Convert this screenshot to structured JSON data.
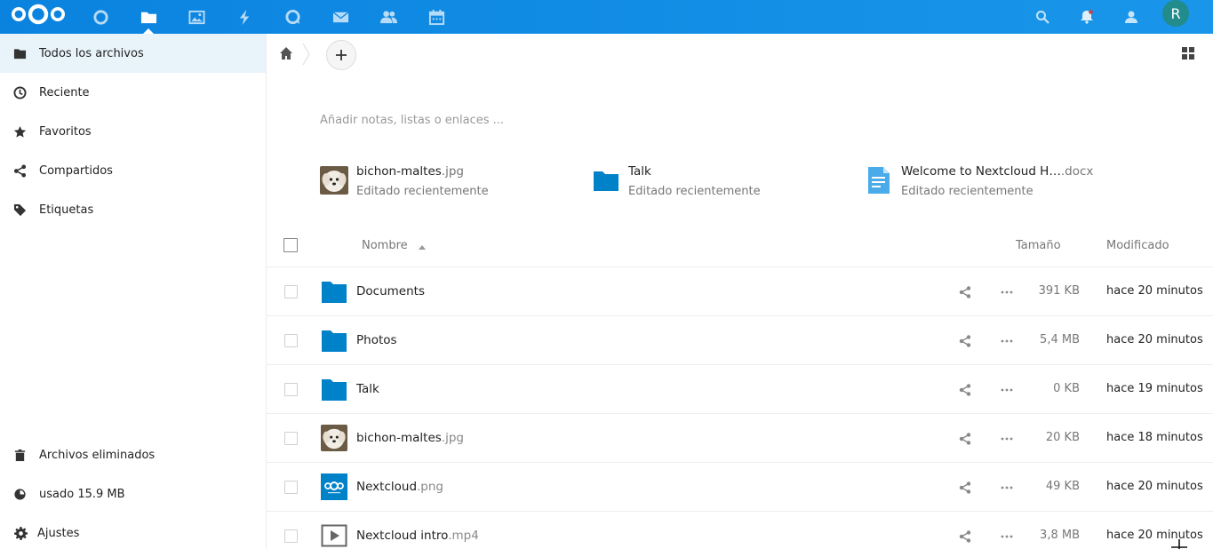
{
  "header": {
    "apps": [
      {
        "name": "dashboard"
      },
      {
        "name": "files",
        "active": true
      },
      {
        "name": "photos"
      },
      {
        "name": "activity"
      },
      {
        "name": "talk"
      },
      {
        "name": "mail"
      },
      {
        "name": "contacts"
      },
      {
        "name": "calendar"
      }
    ],
    "avatar_initial": "R",
    "accent": "#0e8ee9"
  },
  "sidebar": {
    "items": [
      {
        "label": "Todos los archivos",
        "icon": "folder-icon",
        "active": true
      },
      {
        "label": "Reciente",
        "icon": "clock-icon"
      },
      {
        "label": "Favoritos",
        "icon": "star-icon"
      },
      {
        "label": "Compartidos",
        "icon": "share-icon"
      },
      {
        "label": "Etiquetas",
        "icon": "tag-icon"
      }
    ],
    "bottom": {
      "deleted": "Archivos eliminados",
      "quota": "usado 15.9 MB",
      "settings": "Ajustes"
    }
  },
  "main": {
    "notes_placeholder": "Añadir notas, listas o enlaces ...",
    "recent": [
      {
        "name": "bichon-maltes",
        "ext": ".jpg",
        "sub": "Editado recientemente",
        "type": "image"
      },
      {
        "name": "Talk",
        "ext": "",
        "sub": "Editado recientemente",
        "type": "folder"
      },
      {
        "name": "Welcome to Nextcloud H…",
        "ext": ".docx",
        "sub": "Editado recientemente",
        "type": "document"
      }
    ],
    "table": {
      "headers": {
        "name": "Nombre",
        "size": "Tamaño",
        "modified": "Modificado"
      },
      "rows": [
        {
          "name": "Documents",
          "ext": "",
          "type": "folder",
          "size": "391 KB",
          "modified": "hace 20 minutos"
        },
        {
          "name": "Photos",
          "ext": "",
          "type": "folder",
          "size": "5,4 MB",
          "modified": "hace 20 minutos"
        },
        {
          "name": "Talk",
          "ext": "",
          "type": "folder",
          "size": "0 KB",
          "modified": "hace 19 minutos"
        },
        {
          "name": "bichon-maltes",
          "ext": ".jpg",
          "type": "image",
          "size": "20 KB",
          "modified": "hace 18 minutos"
        },
        {
          "name": "Nextcloud",
          "ext": ".png",
          "type": "logo",
          "size": "49 KB",
          "modified": "hace 20 minutos"
        },
        {
          "name": "Nextcloud intro",
          "ext": ".mp4",
          "type": "video",
          "size": "3,8 MB",
          "modified": "hace 20 minutos"
        }
      ]
    }
  }
}
